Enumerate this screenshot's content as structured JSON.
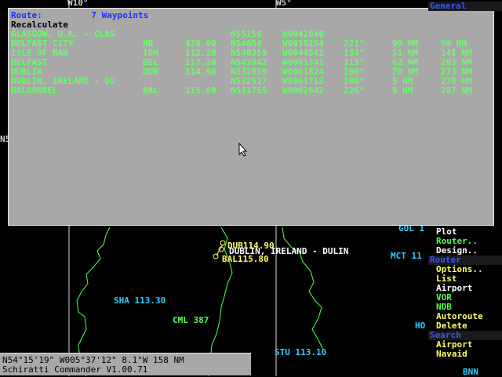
{
  "map": {
    "top_labels": [
      "W10°",
      "W5°"
    ],
    "edge_label_left": "N5",
    "navaids": {
      "dub_label": "DUB114.90",
      "dublin_airport": "DUBLIN, IRELAND - DULIN",
      "bal_label": "BAL115.80",
      "gol_label": "GOL 1",
      "mct_label": "MCT 11",
      "sha_label": "SHA 113.30",
      "cml_label": "CML 387",
      "stu_label": "STU 113.10",
      "ho_label": "HO",
      "bnn_label": "BNN"
    }
  },
  "route": {
    "title": "Route:",
    "waypoint_count": "7 Waypoints",
    "recalculate": "Recalculate",
    "waypoints": [
      {
        "name": "GLASGOW, U.K. - GLAS",
        "id": "",
        "freq": "",
        "lat": "N55150",
        "lon": "W0042640",
        "hdg": "",
        "dist": "",
        "total": ""
      },
      {
        "name": "BELFAST CITY",
        "id": "HB",
        "freq": "420.00",
        "lat": "N54654",
        "lon": "W0055254",
        "hdg": "221°",
        "dist": "90 NM",
        "total": "90 NM"
      },
      {
        "name": "ISLE OF MAN",
        "id": "IOM",
        "freq": "112.20",
        "lat": "N540359",
        "lon": "W0044542",
        "hdg": "138°",
        "dist": "51 NM",
        "total": "141 NM"
      },
      {
        "name": "BELFAST",
        "id": "BEL",
        "freq": "117.20",
        "lat": "N543942",
        "lon": "W0061341",
        "hdg": "313°",
        "dist": "62 NM",
        "total": "203 NM"
      },
      {
        "name": "DUBLIN",
        "id": "DUB",
        "freq": "114.90",
        "lat": "N532959",
        "lon": "W0061824",
        "hdg": "190°",
        "dist": "70 NM",
        "total": "273 NM"
      },
      {
        "name": "DUBLIN, IRELAND - DU",
        "id": "",
        "freq": "",
        "lat": "N532517",
        "lon": "W0061713",
        "hdg": "180°",
        "dist": "5 NM",
        "total": "278 NM"
      },
      {
        "name": "BALDONNEL",
        "id": "BAL",
        "freq": "115.80",
        "lat": "N531759",
        "lon": "W0062642",
        "hdg": "226°",
        "dist": "9 NM",
        "total": "287 NM"
      }
    ]
  },
  "menu": {
    "items": [
      {
        "label": "General",
        "style": "heading"
      },
      {
        "label": "Plot",
        "style": "white"
      },
      {
        "label": "Router..",
        "style": "green"
      },
      {
        "label": "Design..",
        "style": "white"
      },
      {
        "label": "Router",
        "style": "heading"
      },
      {
        "label": "Options..",
        "style": "yellow"
      },
      {
        "label": "List",
        "style": "yellow"
      },
      {
        "label": "Airport",
        "style": "white"
      },
      {
        "label": "VOR",
        "style": "green"
      },
      {
        "label": "NDB",
        "style": "green"
      },
      {
        "label": "Autoroute",
        "style": "yellow"
      },
      {
        "label": "Delete",
        "style": "yellow"
      },
      {
        "label": "Search",
        "style": "heading"
      },
      {
        "label": "Airport",
        "style": "yellow"
      },
      {
        "label": "Navaid",
        "style": "yellow"
      }
    ]
  },
  "status": {
    "line1": "N54°15'19\" W005°37'12\"  8.1°W 158 NM",
    "line2": "Schiratti Commander V1.00.71"
  }
}
